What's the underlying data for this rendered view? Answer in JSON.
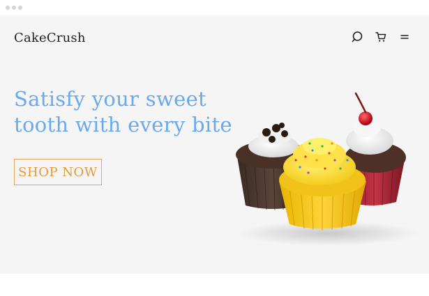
{
  "header": {
    "brand": "CakeCrush",
    "icons": [
      "search-icon",
      "cart-icon",
      "menu-icon"
    ]
  },
  "hero": {
    "headline_line1": "Satisfy your sweet",
    "headline_line2": "tooth with every bite",
    "cta_label": "SHOP NOW",
    "image": "cupcakes-image"
  },
  "colors": {
    "accent_blue": "#6aa9ee",
    "cta_orange": "#e39a3f",
    "background": "#f5f5f5"
  }
}
